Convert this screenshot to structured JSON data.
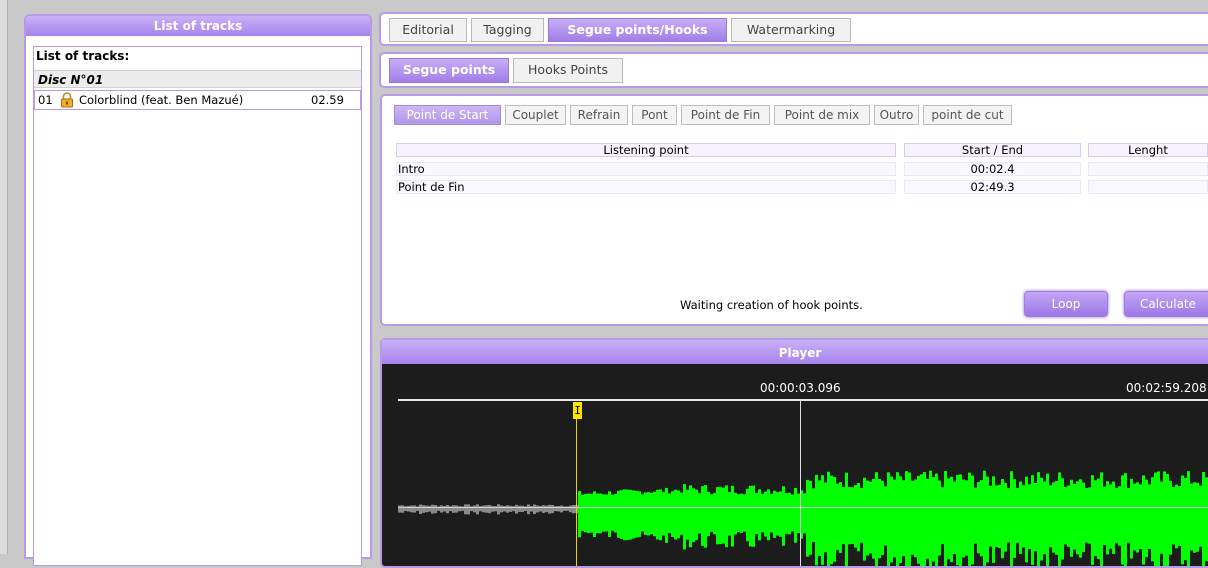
{
  "left_panel": {
    "header": "List of tracks",
    "list_title": "List of tracks:",
    "disc_label": "Disc N°01",
    "tracks": [
      {
        "number": "01",
        "title": "Colorblind (feat. Ben Mazué)",
        "duration": "02.59"
      }
    ]
  },
  "main_tabs": [
    "Editorial",
    "Tagging",
    "Segue points/Hooks",
    "Watermarking"
  ],
  "sub_tabs": [
    "Segue points",
    "Hooks Points"
  ],
  "point_tabs": [
    "Point de Start",
    "Couplet",
    "Refrain",
    "Pont",
    "Point de Fin",
    "Point de mix",
    "Outro",
    "point de cut"
  ],
  "table": {
    "headers": {
      "listening_point": "Listening point",
      "start_end": "Start / End",
      "length": "Lenght"
    },
    "rows": [
      {
        "point": "Intro",
        "time": "00:02.4",
        "length": ""
      },
      {
        "point": "Point de Fin",
        "time": "02:49.3",
        "length": ""
      }
    ]
  },
  "status_text": "Waiting creation of hook points.",
  "buttons": {
    "loop": "Loop",
    "calculate": "Calculate"
  },
  "player": {
    "header": "Player",
    "position_time": "00:00:03.096",
    "total_time": "00:02:59.208",
    "marker_label": "I",
    "waveform_color": "#00ff00",
    "played_color": "#8a8a8a"
  },
  "colors": {
    "accent": "#a683ec",
    "border": "#b79be8"
  }
}
